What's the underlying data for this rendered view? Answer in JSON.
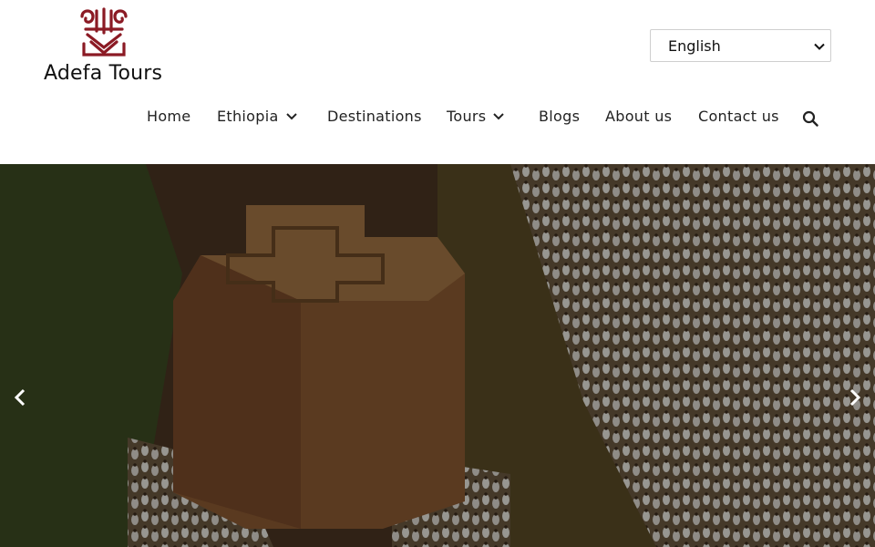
{
  "brand": {
    "name": "Adefa Tours",
    "logo_icon": "ornament-logo-icon",
    "logo_color": "#8b1a24"
  },
  "language_select": {
    "selected": "English",
    "options": [
      "English"
    ]
  },
  "nav": {
    "items": [
      {
        "label": "Home",
        "has_dropdown": false
      },
      {
        "label": "Ethiopia",
        "has_dropdown": true
      },
      {
        "label": "Destinations",
        "has_dropdown": false
      },
      {
        "label": "Tours",
        "has_dropdown": true
      },
      {
        "label": "Blogs",
        "has_dropdown": false
      },
      {
        "label": "About us",
        "has_dropdown": false
      },
      {
        "label": "Contact us",
        "has_dropdown": false
      }
    ],
    "search_icon": "search-icon"
  },
  "hero": {
    "image_subject": "aerial view of a rock-hewn cross-shaped church surrounded by worshippers in white",
    "prev_icon": "chevron-left-icon",
    "next_icon": "chevron-right-icon"
  },
  "colors": {
    "brand_red": "#8b1a24",
    "text": "#222222",
    "overlay": "rgba(0,0,0,0.35)"
  }
}
